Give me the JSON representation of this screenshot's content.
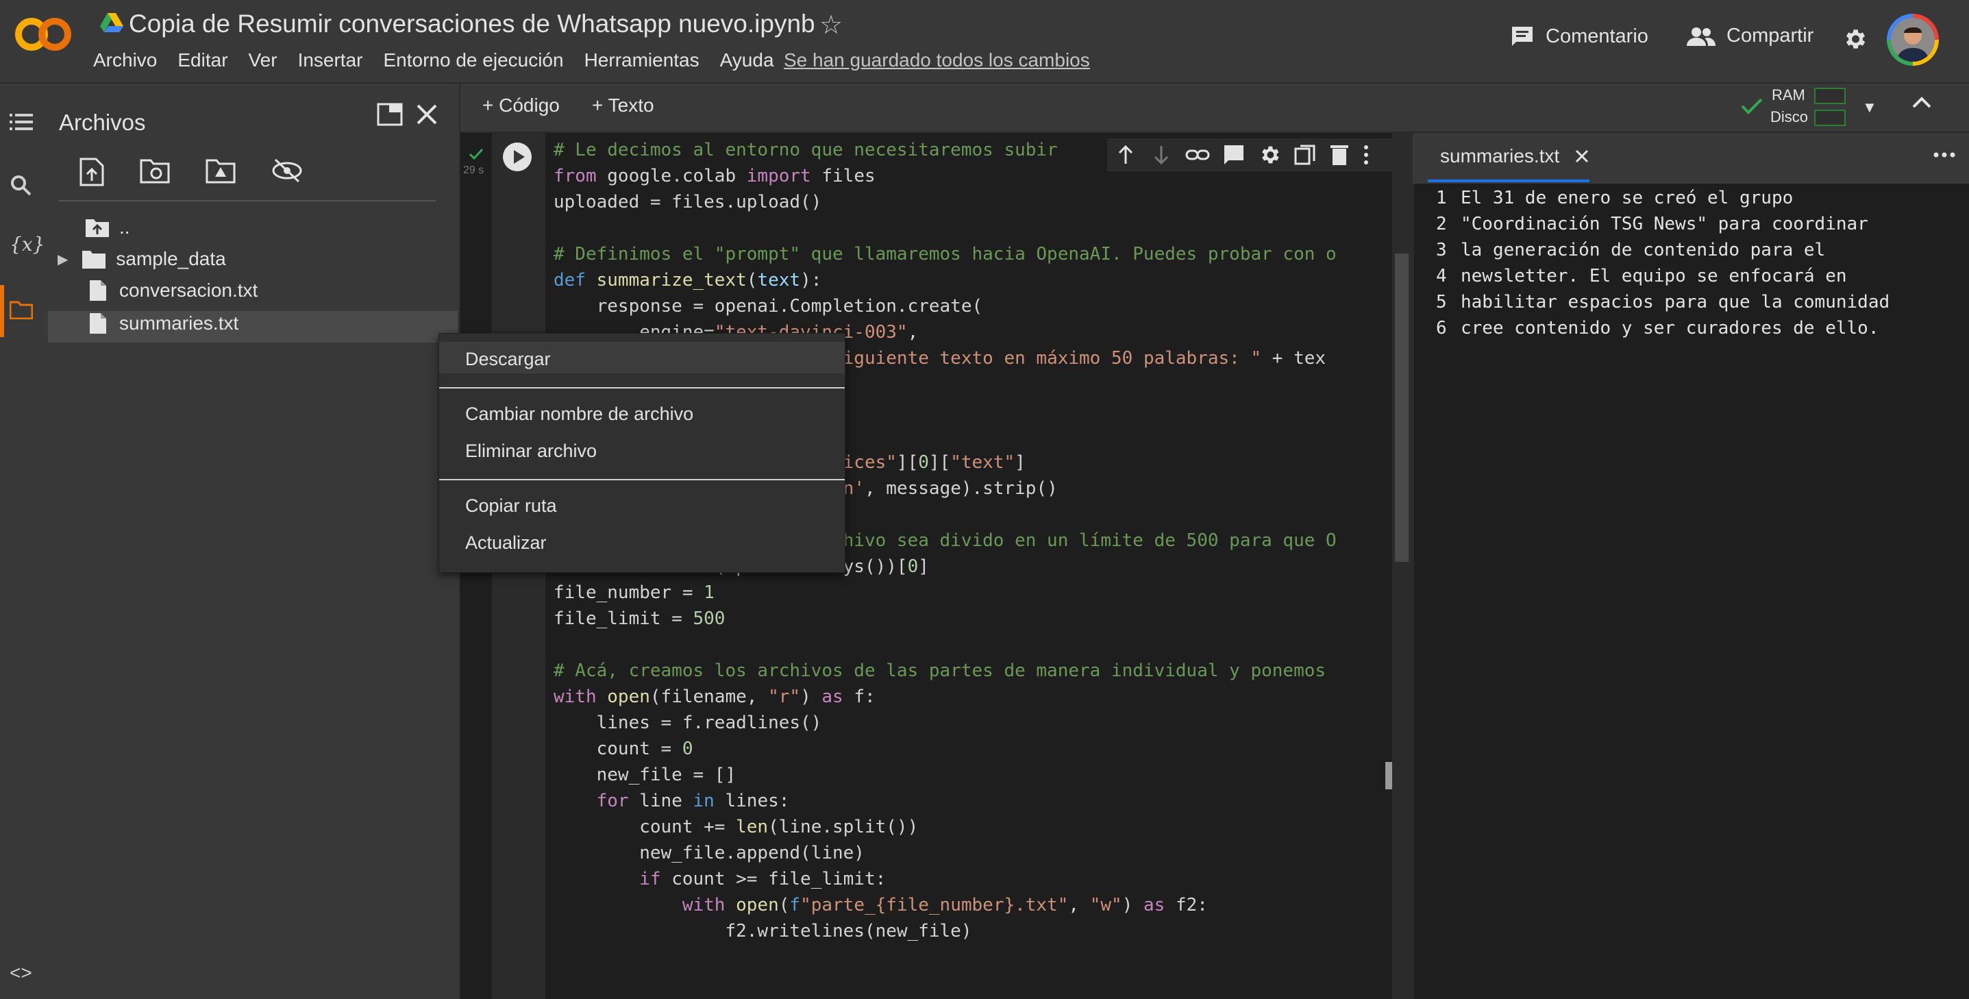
{
  "header": {
    "title": "Copia de Resumir conversaciones de Whatsapp nuevo.ipynb",
    "menu": [
      "Archivo",
      "Editar",
      "Ver",
      "Insertar",
      "Entorno de ejecución",
      "Herramientas",
      "Ayuda"
    ],
    "saved_status": "Se han guardado todos los cambios",
    "comment_label": "Comentario",
    "share_label": "Compartir"
  },
  "files": {
    "panel_title": "Archivos",
    "tree": [
      {
        "name": "..",
        "kind": "parent"
      },
      {
        "name": "sample_data",
        "kind": "folder"
      },
      {
        "name": "conversacion.txt",
        "kind": "file"
      },
      {
        "name": "summaries.txt",
        "kind": "file",
        "selected": true
      }
    ]
  },
  "context_menu": {
    "items": [
      "Descargar",
      "Cambiar nombre de archivo",
      "Eliminar archivo",
      "Copiar ruta",
      "Actualizar"
    ]
  },
  "toolbar": {
    "add_code": "+ Código",
    "add_text": "+ Texto",
    "ram_label": "RAM",
    "disk_label": "Disco"
  },
  "cell": {
    "exec_time": "29 s"
  },
  "viewer": {
    "tab_label": "summaries.txt",
    "lines": [
      "El 31 de enero se creó el grupo",
      "\"Coordinación TSG News\" para coordinar",
      "la generación de contenido para el",
      "newsletter. El equipo se enfocará en",
      "habilitar espacios para que la comunidad",
      "cree contenido y ser curadores de ello."
    ]
  },
  "colors": {
    "accent_orange": "#e8710a",
    "accent_blue": "#1a73e8",
    "ok_green": "#34a853"
  }
}
